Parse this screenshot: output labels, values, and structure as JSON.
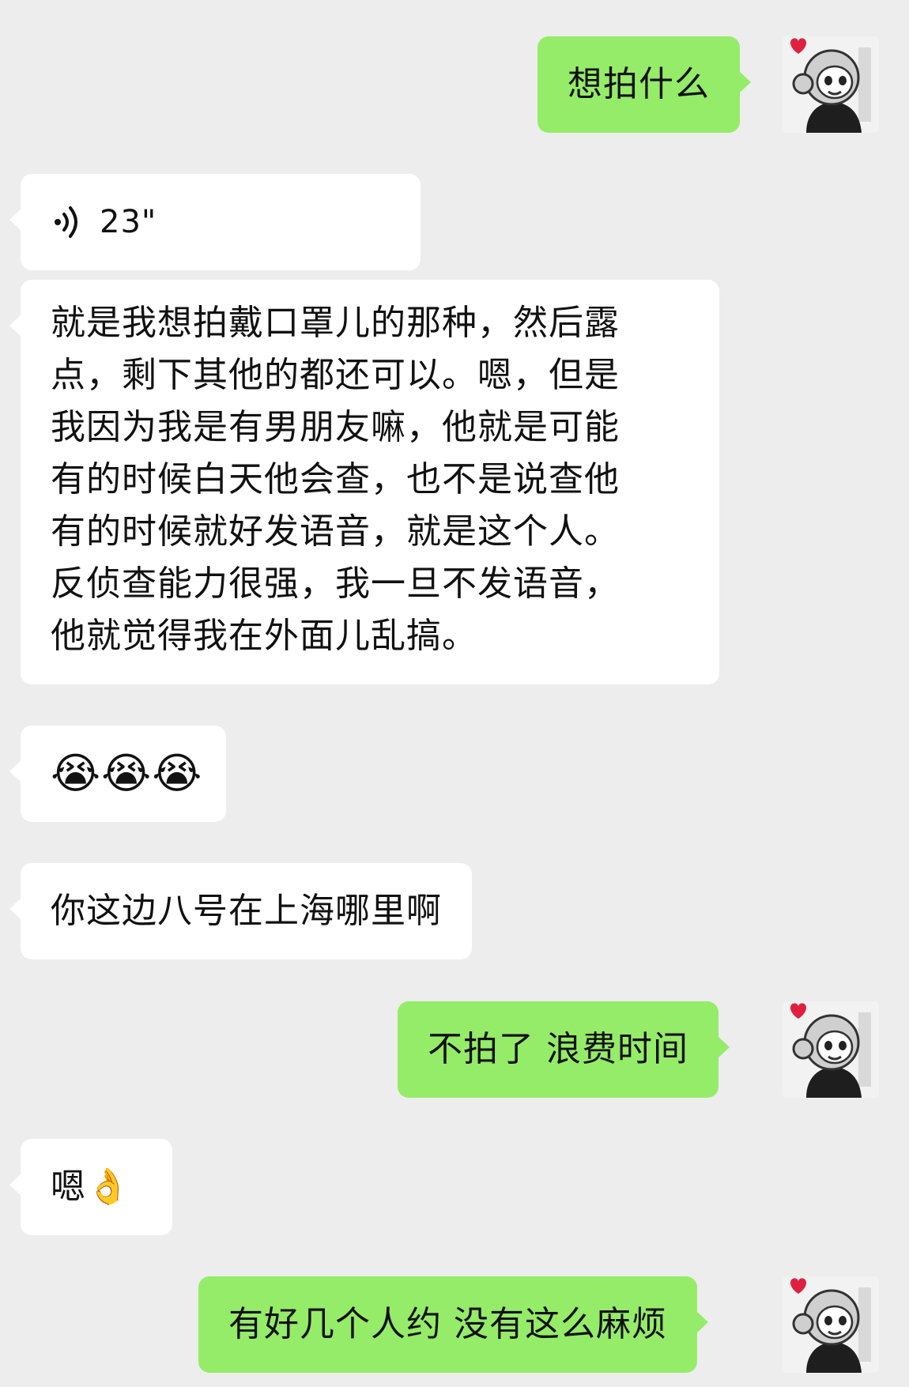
{
  "messages": [
    {
      "id": "m1",
      "side": "out",
      "text": "想拍什么"
    },
    {
      "id": "m2",
      "side": "in",
      "type": "voice",
      "duration": "23\""
    },
    {
      "id": "m3",
      "side": "in",
      "type": "text",
      "lines": [
        "就是我想拍戴口罩儿的那种，然后露",
        "点，剩下其他的都还可以。嗯，但是",
        "我因为我是有男朋友嘛，他就是可能",
        "有的时候白天他会查，也不是说查他",
        "有的时候就好发语音，就是这个人。",
        "反侦查能力很强，我一旦不发语音，",
        "他就觉得我在外面儿乱搞。"
      ]
    },
    {
      "id": "m4",
      "side": "in",
      "type": "emoji",
      "text": "😭😭😭"
    },
    {
      "id": "m5",
      "side": "in",
      "text": "你这边八号在上海哪里啊"
    },
    {
      "id": "m6",
      "side": "out",
      "text": "不拍了 浪费时间"
    },
    {
      "id": "m7",
      "side": "in",
      "text": "嗯👌"
    },
    {
      "id": "m8",
      "side": "out",
      "text": "有好几个人约 没有这么麻烦"
    }
  ],
  "avatar": {
    "icon": "cartoon-monkey-avatar-icon"
  },
  "colors": {
    "background": "#ededed",
    "incoming_bubble": "#ffffff",
    "outgoing_bubble": "#95ec69",
    "text": "#111111"
  }
}
